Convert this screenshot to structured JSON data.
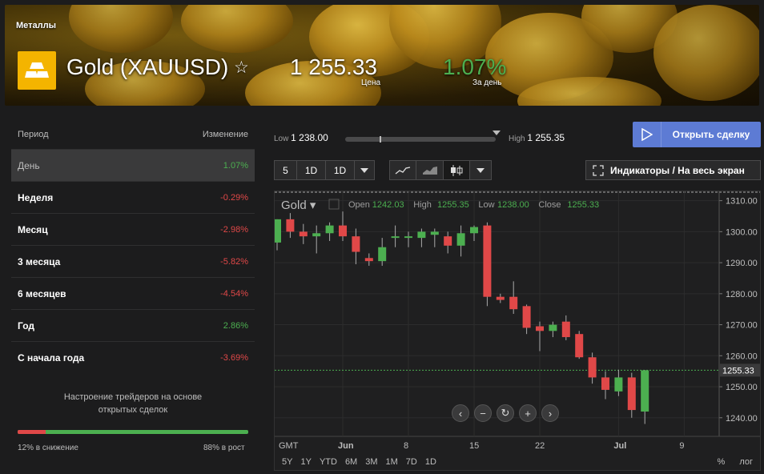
{
  "header": {
    "breadcrumb": "Металлы",
    "title": "Gold (XAUUSD)",
    "price": "1 255.33",
    "price_label": "Цена",
    "change": "1.07%",
    "change_label": "За день",
    "accent_icon_color": "#f4b400"
  },
  "performance": {
    "col_period": "Период",
    "col_change": "Изменение",
    "rows": [
      {
        "name": "День",
        "value": "1.07%",
        "dir": "pos"
      },
      {
        "name": "Неделя",
        "value": "-0.29%",
        "dir": "neg"
      },
      {
        "name": "Месяц",
        "value": "-2.98%",
        "dir": "neg"
      },
      {
        "name": "3 месяца",
        "value": "-5.82%",
        "dir": "neg"
      },
      {
        "name": "6 месяцев",
        "value": "-4.54%",
        "dir": "neg"
      },
      {
        "name": "Год",
        "value": "2.86%",
        "dir": "pos"
      },
      {
        "name": "С начала года",
        "value": "-3.69%",
        "dir": "neg"
      }
    ]
  },
  "sentiment": {
    "text_line1": "Настроение трейдеров на основе",
    "text_line2": "открытых сделок",
    "down_pct": 12,
    "down_label": "12% в снижение",
    "up_label": "88% в рост"
  },
  "range": {
    "low_label": "Low",
    "low_value": "1 238.00",
    "high_label": "High",
    "high_value": "1 255.35"
  },
  "trade_button": "Открыть сделку",
  "toolbar": {
    "interval_buttons": [
      "5",
      "1D",
      "1D"
    ],
    "indicators_label": "Индикаторы / На весь экран"
  },
  "chart_data": {
    "type": "candlestick",
    "symbol": "Gold",
    "ohlc_labels": {
      "open": "Open",
      "high": "High",
      "low": "Low",
      "close": "Close"
    },
    "ohlc_values": {
      "open": "1242.03",
      "high": "1255.35",
      "low": "1238.00",
      "close": "1255.33"
    },
    "ylim": [
      1234,
      1313
    ],
    "yticks": [
      "1310.00",
      "1300.00",
      "1290.00",
      "1280.00",
      "1270.00",
      "1260.00",
      "1250.00",
      "1240.00"
    ],
    "ytick_values": [
      1310,
      1300,
      1290,
      1280,
      1270,
      1260,
      1250,
      1240
    ],
    "xticks": [
      {
        "label": "GMT",
        "i": -1
      },
      {
        "label": "Jun",
        "i": 5
      },
      {
        "label": "8",
        "i": 10
      },
      {
        "label": "15",
        "i": 15
      },
      {
        "label": "22",
        "i": 20
      },
      {
        "label": "Jul",
        "i": 26
      },
      {
        "label": "9",
        "i": 31
      }
    ],
    "current_price": "1255.33",
    "current_value": 1255.33,
    "candles": [
      {
        "o": 1296.5,
        "h": 1304.0,
        "l": 1294.0,
        "c": 1304.0
      },
      {
        "o": 1304.0,
        "h": 1306.0,
        "l": 1298.0,
        "c": 1300.0
      },
      {
        "o": 1300.0,
        "h": 1302.5,
        "l": 1296.0,
        "c": 1298.5
      },
      {
        "o": 1298.5,
        "h": 1302.0,
        "l": 1293.0,
        "c": 1299.5
      },
      {
        "o": 1299.5,
        "h": 1303.0,
        "l": 1297.0,
        "c": 1302.0
      },
      {
        "o": 1302.0,
        "h": 1306.5,
        "l": 1297.0,
        "c": 1298.5
      },
      {
        "o": 1298.5,
        "h": 1301.0,
        "l": 1289.5,
        "c": 1293.5
      },
      {
        "o": 1291.5,
        "h": 1293.0,
        "l": 1289.0,
        "c": 1290.5
      },
      {
        "o": 1290.5,
        "h": 1298.0,
        "l": 1289.0,
        "c": 1295.0
      },
      {
        "o": 1298.0,
        "h": 1302.0,
        "l": 1295.0,
        "c": 1298.5
      },
      {
        "o": 1298.0,
        "h": 1300.0,
        "l": 1295.0,
        "c": 1298.5
      },
      {
        "o": 1298.0,
        "h": 1301.0,
        "l": 1295.0,
        "c": 1300.0
      },
      {
        "o": 1299.0,
        "h": 1301.0,
        "l": 1295.0,
        "c": 1300.0
      },
      {
        "o": 1298.5,
        "h": 1300.0,
        "l": 1293.0,
        "c": 1295.5
      },
      {
        "o": 1295.5,
        "h": 1302.0,
        "l": 1292.0,
        "c": 1299.5
      },
      {
        "o": 1299.5,
        "h": 1302.0,
        "l": 1297.0,
        "c": 1301.5
      },
      {
        "o": 1302.0,
        "h": 1303.0,
        "l": 1276.0,
        "c": 1279.0
      },
      {
        "o": 1279.0,
        "h": 1280.0,
        "l": 1277.0,
        "c": 1278.0
      },
      {
        "o": 1279.0,
        "h": 1284.0,
        "l": 1273.5,
        "c": 1275.0
      },
      {
        "o": 1276.0,
        "h": 1276.5,
        "l": 1267.0,
        "c": 1269.0
      },
      {
        "o": 1269.5,
        "h": 1271.0,
        "l": 1261.5,
        "c": 1268.0
      },
      {
        "o": 1268.0,
        "h": 1271.0,
        "l": 1266.0,
        "c": 1270.0
      },
      {
        "o": 1271.0,
        "h": 1273.0,
        "l": 1265.0,
        "c": 1266.0
      },
      {
        "o": 1267.0,
        "h": 1268.0,
        "l": 1259.0,
        "c": 1259.5
      },
      {
        "o": 1259.5,
        "h": 1261.0,
        "l": 1251.0,
        "c": 1253.0
      },
      {
        "o": 1253.0,
        "h": 1255.0,
        "l": 1246.0,
        "c": 1249.0
      },
      {
        "o": 1248.5,
        "h": 1255.5,
        "l": 1247.0,
        "c": 1253.0
      },
      {
        "o": 1253.0,
        "h": 1254.5,
        "l": 1240.0,
        "c": 1242.5
      },
      {
        "o": 1242.0,
        "h": 1255.4,
        "l": 1238.0,
        "c": 1255.3
      }
    ]
  },
  "chart_controls": [
    "prev",
    "zoom-out",
    "reset",
    "zoom-in",
    "next"
  ],
  "periods": [
    "5Y",
    "1Y",
    "YTD",
    "6M",
    "3M",
    "1M",
    "7D",
    "1D"
  ],
  "period_right": [
    "%",
    "лог"
  ],
  "colors": {
    "up": "#4caf50",
    "down": "#e04848",
    "accent": "#5d7bd4"
  }
}
